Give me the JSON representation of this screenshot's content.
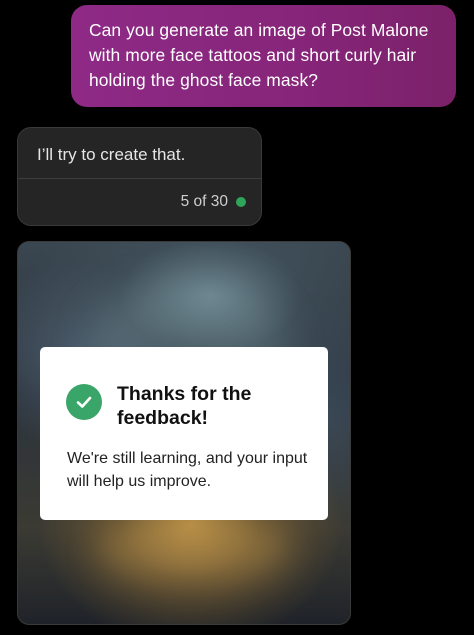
{
  "user_message": {
    "text": "Can you generate an image of Post Malone with more face tattoos and short curly hair holding the ghost face mask?"
  },
  "bot_message": {
    "text": "I’ll try to create that.",
    "counter": "5 of 30",
    "counter_dot_color": "#2ea55a"
  },
  "feedback": {
    "title": "Thanks for the feedback!",
    "body": "We're still learning, and your input will help us improve.",
    "check_color": "#3aa568",
    "icon": "checkmark-icon"
  },
  "colors": {
    "background": "#000000",
    "user_bubble": "#8a2880",
    "bot_bubble": "#252525"
  }
}
